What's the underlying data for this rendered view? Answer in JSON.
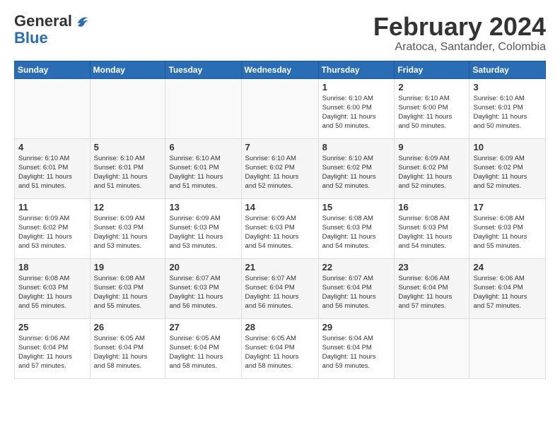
{
  "header": {
    "logo_general": "General",
    "logo_blue": "Blue",
    "month_title": "February 2024",
    "location": "Aratoca, Santander, Colombia"
  },
  "weekdays": [
    "Sunday",
    "Monday",
    "Tuesday",
    "Wednesday",
    "Thursday",
    "Friday",
    "Saturday"
  ],
  "weeks": [
    [
      {
        "day": "",
        "info": ""
      },
      {
        "day": "",
        "info": ""
      },
      {
        "day": "",
        "info": ""
      },
      {
        "day": "",
        "info": ""
      },
      {
        "day": "1",
        "info": "Sunrise: 6:10 AM\nSunset: 6:00 PM\nDaylight: 11 hours\nand 50 minutes."
      },
      {
        "day": "2",
        "info": "Sunrise: 6:10 AM\nSunset: 6:00 PM\nDaylight: 11 hours\nand 50 minutes."
      },
      {
        "day": "3",
        "info": "Sunrise: 6:10 AM\nSunset: 6:01 PM\nDaylight: 11 hours\nand 50 minutes."
      }
    ],
    [
      {
        "day": "4",
        "info": "Sunrise: 6:10 AM\nSunset: 6:01 PM\nDaylight: 11 hours\nand 51 minutes."
      },
      {
        "day": "5",
        "info": "Sunrise: 6:10 AM\nSunset: 6:01 PM\nDaylight: 11 hours\nand 51 minutes."
      },
      {
        "day": "6",
        "info": "Sunrise: 6:10 AM\nSunset: 6:01 PM\nDaylight: 11 hours\nand 51 minutes."
      },
      {
        "day": "7",
        "info": "Sunrise: 6:10 AM\nSunset: 6:02 PM\nDaylight: 11 hours\nand 52 minutes."
      },
      {
        "day": "8",
        "info": "Sunrise: 6:10 AM\nSunset: 6:02 PM\nDaylight: 11 hours\nand 52 minutes."
      },
      {
        "day": "9",
        "info": "Sunrise: 6:09 AM\nSunset: 6:02 PM\nDaylight: 11 hours\nand 52 minutes."
      },
      {
        "day": "10",
        "info": "Sunrise: 6:09 AM\nSunset: 6:02 PM\nDaylight: 11 hours\nand 52 minutes."
      }
    ],
    [
      {
        "day": "11",
        "info": "Sunrise: 6:09 AM\nSunset: 6:02 PM\nDaylight: 11 hours\nand 53 minutes."
      },
      {
        "day": "12",
        "info": "Sunrise: 6:09 AM\nSunset: 6:03 PM\nDaylight: 11 hours\nand 53 minutes."
      },
      {
        "day": "13",
        "info": "Sunrise: 6:09 AM\nSunset: 6:03 PM\nDaylight: 11 hours\nand 53 minutes."
      },
      {
        "day": "14",
        "info": "Sunrise: 6:09 AM\nSunset: 6:03 PM\nDaylight: 11 hours\nand 54 minutes."
      },
      {
        "day": "15",
        "info": "Sunrise: 6:08 AM\nSunset: 6:03 PM\nDaylight: 11 hours\nand 54 minutes."
      },
      {
        "day": "16",
        "info": "Sunrise: 6:08 AM\nSunset: 6:03 PM\nDaylight: 11 hours\nand 54 minutes."
      },
      {
        "day": "17",
        "info": "Sunrise: 6:08 AM\nSunset: 6:03 PM\nDaylight: 11 hours\nand 55 minutes."
      }
    ],
    [
      {
        "day": "18",
        "info": "Sunrise: 6:08 AM\nSunset: 6:03 PM\nDaylight: 11 hours\nand 55 minutes."
      },
      {
        "day": "19",
        "info": "Sunrise: 6:08 AM\nSunset: 6:03 PM\nDaylight: 11 hours\nand 55 minutes."
      },
      {
        "day": "20",
        "info": "Sunrise: 6:07 AM\nSunset: 6:03 PM\nDaylight: 11 hours\nand 56 minutes."
      },
      {
        "day": "21",
        "info": "Sunrise: 6:07 AM\nSunset: 6:04 PM\nDaylight: 11 hours\nand 56 minutes."
      },
      {
        "day": "22",
        "info": "Sunrise: 6:07 AM\nSunset: 6:04 PM\nDaylight: 11 hours\nand 56 minutes."
      },
      {
        "day": "23",
        "info": "Sunrise: 6:06 AM\nSunset: 6:04 PM\nDaylight: 11 hours\nand 57 minutes."
      },
      {
        "day": "24",
        "info": "Sunrise: 6:06 AM\nSunset: 6:04 PM\nDaylight: 11 hours\nand 57 minutes."
      }
    ],
    [
      {
        "day": "25",
        "info": "Sunrise: 6:06 AM\nSunset: 6:04 PM\nDaylight: 11 hours\nand 57 minutes."
      },
      {
        "day": "26",
        "info": "Sunrise: 6:05 AM\nSunset: 6:04 PM\nDaylight: 11 hours\nand 58 minutes."
      },
      {
        "day": "27",
        "info": "Sunrise: 6:05 AM\nSunset: 6:04 PM\nDaylight: 11 hours\nand 58 minutes."
      },
      {
        "day": "28",
        "info": "Sunrise: 6:05 AM\nSunset: 6:04 PM\nDaylight: 11 hours\nand 58 minutes."
      },
      {
        "day": "29",
        "info": "Sunrise: 6:04 AM\nSunset: 6:04 PM\nDaylight: 11 hours\nand 59 minutes."
      },
      {
        "day": "",
        "info": ""
      },
      {
        "day": "",
        "info": ""
      }
    ]
  ]
}
